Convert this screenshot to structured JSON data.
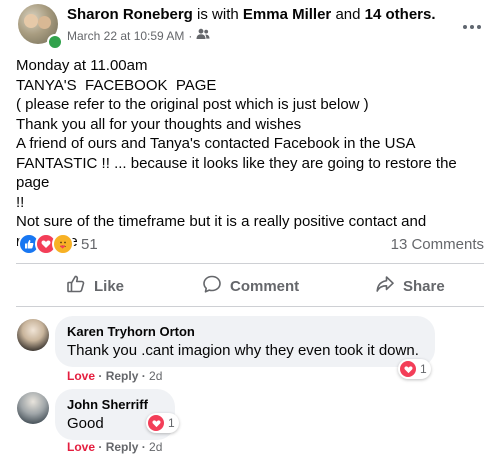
{
  "post": {
    "author": "Sharon Roneberg",
    "with_text": "is with",
    "tagged": "Emma Miller",
    "and_text": "and",
    "others": "14 others.",
    "date": "March 22 at 10:59 AM",
    "dot": "·",
    "text": "Monday at 11.00am\nTANYA'S  FACEBOOK  PAGE\n( please refer to the original post which is just below )\nThank you all for your thoughts and wishes\nA friend of ours and Tanya's contacted Facebook in the USA\nFANTASTIC !! ... because it looks like they are going to restore the page\n!!\nNot sure of the timeframe but it is a really positive contact and\nresponse"
  },
  "reactions": {
    "count": "51",
    "types": [
      "like-icon",
      "love-icon",
      "care-icon"
    ]
  },
  "comments_count": "13 Comments",
  "actions": {
    "like": "Like",
    "comment": "Comment",
    "share": "Share"
  },
  "comments": [
    {
      "name": "Karen Tryhorn Orton",
      "text": "Thank you .cant imagion why they even took it down.",
      "love": "Love",
      "reply": "Reply",
      "age": "2d",
      "reaction_count": "1"
    },
    {
      "name": "John Sherriff",
      "text": "Good",
      "love": "Love",
      "reply": "Reply",
      "age": "2d",
      "reaction_count": "1"
    }
  ],
  "colors": {
    "like_blue": "#1877f2",
    "love_red": "#f33e58",
    "muted_text": "#65676b",
    "bubble_bg": "#f0f2f5"
  }
}
